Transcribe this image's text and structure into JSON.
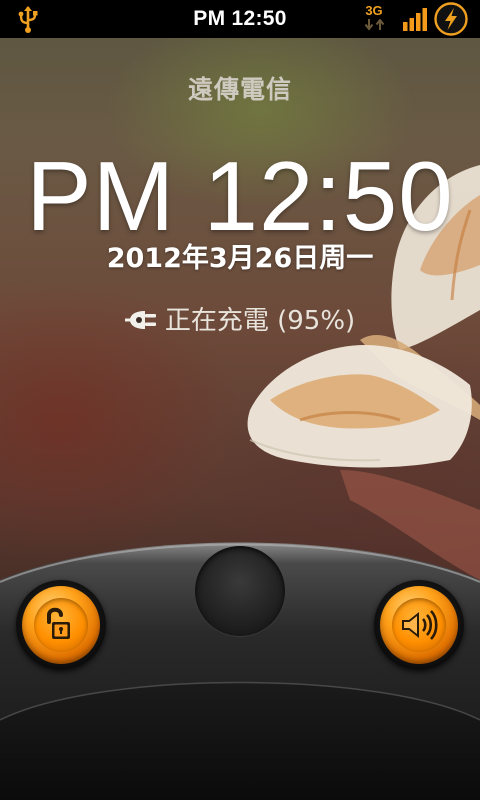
{
  "status_bar": {
    "time": "PM 12:50",
    "network": "3G",
    "icons": [
      "usb-icon",
      "3g-data-icon",
      "signal-strength-icon",
      "battery-charging-icon"
    ]
  },
  "lockscreen": {
    "carrier": "遠傳電信",
    "clock": "PM 12:50",
    "date": "2012年3月26日周一",
    "charging_text": "正在充電 (95%)",
    "battery_level": 0.95
  },
  "dock": {
    "left_action": "unlock-icon",
    "right_action": "sound-icon"
  },
  "colors": {
    "accent": "#ff9a1a",
    "status_bar_bg": "#000000",
    "text": "#ffffff"
  }
}
